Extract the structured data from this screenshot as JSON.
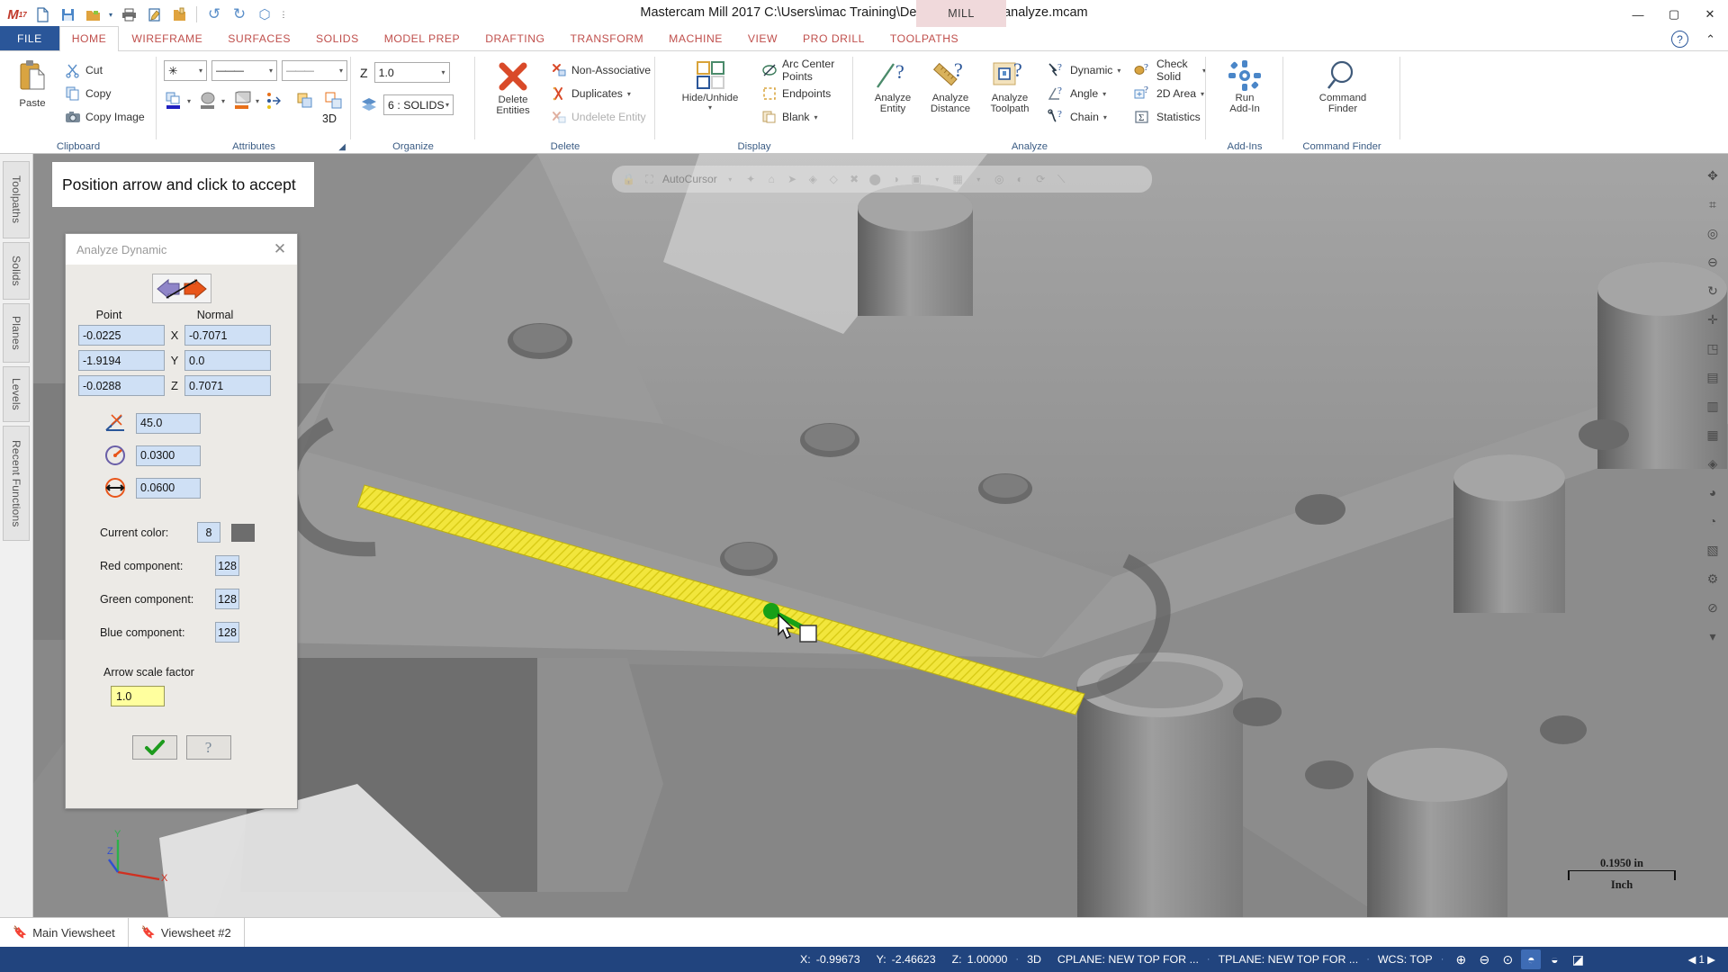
{
  "window": {
    "title": "Mastercam Mill 2017  C:\\Users\\imac Training\\Desktop\\dynamic analyze.mcam",
    "mill_tab": "MILL",
    "minimize": "—",
    "maximize": "▢",
    "close": "✕"
  },
  "quick_access": [
    {
      "name": "mastercam-logo-icon",
      "glyph": "M"
    },
    {
      "name": "new-file-icon",
      "glyph": "🗋"
    },
    {
      "name": "save-icon",
      "glyph": "🖫"
    },
    {
      "name": "open-file-icon",
      "glyph": "🗀"
    },
    {
      "name": "open-dropdown-icon",
      "glyph": "▾"
    },
    {
      "name": "print-icon",
      "glyph": "🖶"
    },
    {
      "name": "edit-icon",
      "glyph": "🗒"
    },
    {
      "name": "folder-icon",
      "glyph": "🗂"
    },
    {
      "name": "undo-icon",
      "glyph": "↺"
    },
    {
      "name": "redo-icon",
      "glyph": "↻"
    },
    {
      "name": "rotate-icon",
      "glyph": "⬡"
    },
    {
      "name": "customize-qa-icon",
      "glyph": "▾"
    }
  ],
  "ribbon": {
    "tabs": [
      {
        "label": "FILE",
        "kind": "file"
      },
      {
        "label": "HOME",
        "kind": "active"
      },
      {
        "label": "WIREFRAME",
        "kind": "normal"
      },
      {
        "label": "SURFACES",
        "kind": "normal"
      },
      {
        "label": "SOLIDS",
        "kind": "normal"
      },
      {
        "label": "MODEL PREP",
        "kind": "normal"
      },
      {
        "label": "DRAFTING",
        "kind": "normal"
      },
      {
        "label": "TRANSFORM",
        "kind": "normal"
      },
      {
        "label": "MACHINE",
        "kind": "normal"
      },
      {
        "label": "VIEW",
        "kind": "normal"
      },
      {
        "label": "PRO DRILL",
        "kind": "normal"
      },
      {
        "label": "TOOLPATHS",
        "kind": "normal"
      }
    ],
    "groups": [
      {
        "name": "clipboard",
        "label": "Clipboard"
      },
      {
        "name": "attributes",
        "label": "Attributes"
      },
      {
        "name": "organize",
        "label": "Organize"
      },
      {
        "name": "delete",
        "label": "Delete"
      },
      {
        "name": "display",
        "label": "Display"
      },
      {
        "name": "analyze",
        "label": "Analyze"
      },
      {
        "name": "addins",
        "label": "Add-Ins"
      },
      {
        "name": "command-finder",
        "label": "Command Finder"
      }
    ],
    "clipboard": {
      "paste": "Paste",
      "cut": "Cut",
      "copy": "Copy",
      "copy_image": "Copy Image"
    },
    "attributes": {
      "point_style": "✳",
      "line_style": "———",
      "line_weight": "———",
      "dimension_mode": "3D"
    },
    "organize": {
      "z_label": "Z",
      "z_value": "1.0",
      "level_value": "6 : SOLIDS"
    },
    "delete": {
      "delete_entities_l1": "Delete",
      "delete_entities_l2": "Entities",
      "non_associative": "Non-Associative",
      "duplicates": "Duplicates",
      "undelete_entity": "Undelete Entity"
    },
    "display": {
      "hide_unhide_l1": "Hide/Unhide",
      "arc_center_points": "Arc Center Points",
      "endpoints": "Endpoints",
      "blank": "Blank"
    },
    "analyze": {
      "entity_l1": "Analyze",
      "entity_l2": "Entity",
      "distance_l1": "Analyze",
      "distance_l2": "Distance",
      "toolpath_l1": "Analyze",
      "toolpath_l2": "Toolpath",
      "dynamic": "Dynamic",
      "angle": "Angle",
      "chain": "Chain",
      "check_solid": "Check Solid",
      "area_2d": "2D Area",
      "statistics": "Statistics"
    },
    "addins": {
      "run_l1": "Run",
      "run_l2": "Add-In"
    },
    "command_finder": {
      "l1": "Command",
      "l2": "Finder"
    }
  },
  "left_tabs": [
    "Toolpaths",
    "Solids",
    "Planes",
    "Levels",
    "Recent Functions"
  ],
  "autocursor": {
    "label": "AutoCursor",
    "icons": [
      "lock-icon",
      "cursor-select-icon",
      "caret-icon",
      "origin-icon",
      "arc-center-icon",
      "arrow-pointer-icon",
      "endpoint-icon",
      "midpoint-icon",
      "intersection-icon",
      "center-icon",
      "quadrant-icon",
      "point-icon",
      "caret-icon",
      "grid-icon",
      "caret-icon",
      "relative-icon",
      "tangent-icon",
      "nearest-icon",
      "perpendicular-icon"
    ]
  },
  "prompt": {
    "text": "Position arrow and click to accept"
  },
  "dialog": {
    "title": "Analyze Dynamic",
    "close": "✕",
    "arrow_button_name": "flip-arrow-button",
    "headers": {
      "point": "Point",
      "normal": "Normal"
    },
    "rows": [
      {
        "axis": "X",
        "point": "-0.0225",
        "normal": "-0.7071"
      },
      {
        "axis": "Y",
        "point": "-1.9194",
        "normal": "0.0"
      },
      {
        "axis": "Z",
        "point": "-0.0288",
        "normal": "0.7071"
      }
    ],
    "angle_value": "45.0",
    "radius_value": "0.0300",
    "diameter_value": "0.0600",
    "current_color_label": "Current color:",
    "current_color_value": "8",
    "current_color_hex": "#6d6d6d",
    "red_label": "Red component:",
    "red_value": "128",
    "green_label": "Green component:",
    "green_value": "128",
    "blue_label": "Blue component:",
    "blue_value": "128",
    "arrow_scale_label": "Arrow scale factor",
    "arrow_scale_value": "1.0",
    "ok_glyph": "✔",
    "help_glyph": "?"
  },
  "viewport": {
    "scale_value": "0.1950 in",
    "scale_unit": "Inch",
    "axis_labels": {
      "x": "X",
      "y": "Y",
      "z": "Z"
    }
  },
  "sheet_tabs": [
    {
      "label": "Main Viewsheet",
      "active": false
    },
    {
      "label": "Viewsheet #2",
      "active": true
    }
  ],
  "statusbar": {
    "x_label": "X:",
    "x_value": "-0.99673",
    "y_label": "Y:",
    "y_value": "-2.46623",
    "z_label": "Z:",
    "z_value": "1.00000",
    "mode": "3D",
    "cplane": "CPLANE: NEW TOP FOR ...",
    "tplane": "TPLANE: NEW TOP FOR ...",
    "wcs": "WCS: TOP",
    "icons": [
      "wireframe-icon",
      "shaded-wireframe-icon",
      "hidden-line-icon",
      "shaded-icon",
      "shaded-translucent-icon",
      "material-icon"
    ],
    "page_nav": "◀ 1 ▶"
  },
  "colors": {
    "ribbon_accent": "#c0504d",
    "file_tab": "#2a5699",
    "statusbar": "#21447e",
    "viewport_bg": "#8b8b8b",
    "highlight_yellow": "#f2e63c",
    "selection_green": "#1a9e1a"
  }
}
